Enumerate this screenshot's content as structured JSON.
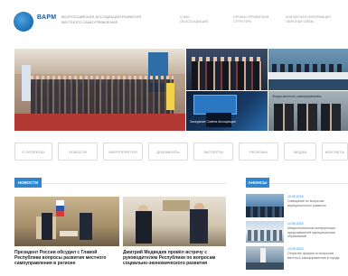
{
  "header": {
    "logo_text": "ВАРМ",
    "org_name_lines": [
      "ВСЕРОССИЙСКАЯ АССОЦИАЦИЯ РАЗВИТИЯ",
      "МЕСТНОГО САМОУПРАВЛЕНИЯ"
    ],
    "links": [
      {
        "line1": "О НАС",
        "line2": "ОБ АССОЦИАЦИИ"
      },
      {
        "line1": "ОРГАНЫ УПРАВЛЕНИЯ",
        "line2": "СТРУКТУРА"
      },
      {
        "line1": "КОНТАКТНАЯ ИНФОРМАЦИЯ",
        "line2": "ОБРАТНАЯ СВЯЗЬ"
      }
    ]
  },
  "hero": {
    "captions": [
      "Заседание Совета Ассоциации",
      "Форум местного самоуправления"
    ]
  },
  "categories": [
    "О ПРОЕКТАХ",
    "НОВОСТИ",
    "МЕРОПРИЯТИЯ",
    "ДОКУМЕНТЫ",
    "ЭКСПЕРТЫ",
    "РЕГИОНЫ",
    "МЕДИА",
    "КОНТАКТЫ"
  ],
  "sections": {
    "news_label": "НОВОСТИ",
    "events_label": "АНОНСЫ"
  },
  "news": [
    {
      "title": "Президент России обсудил с Главой Республики вопросы развития местного самоуправления в регионе"
    },
    {
      "title": "Дмитрий Медведев провёл встречу с руководителем Республики по вопросам социально-экономического развития"
    }
  ],
  "sidebar_items": [
    {
      "date": "15.05.2015",
      "text": "Совещание по вопросам муниципального развития"
    },
    {
      "date": "14.05.2015",
      "text": "Межрегиональная конференция представителей муниципальных образований"
    },
    {
      "date": "13.05.2015",
      "text": "Открытие форума по вопросам местного самоуправления в городе"
    }
  ],
  "colors": {
    "accent": "#2f86cf",
    "brand": "#1a5a96",
    "hero_floor": "#b33a34"
  }
}
